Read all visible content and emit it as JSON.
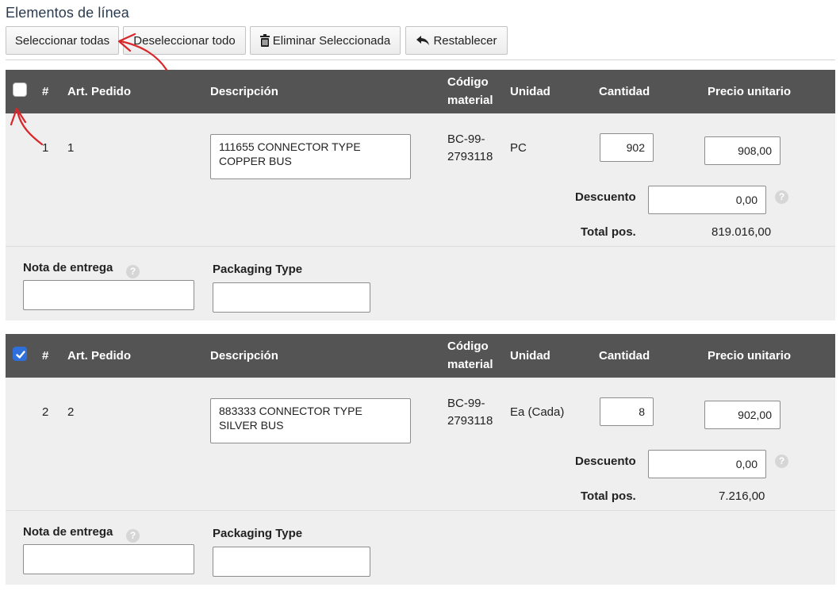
{
  "page": {
    "title": "Elementos de línea"
  },
  "toolbar": {
    "select_all": "Seleccionar todas",
    "deselect_all": "Deseleccionar todo",
    "delete_selected": "Eliminar Seleccionada",
    "reset": "Restablecer"
  },
  "columns": {
    "number": "#",
    "order_item": "Art. Pedido",
    "description": "Descripción",
    "material_code_line1": "Código",
    "material_code_line2": "material",
    "unit": "Unidad",
    "quantity": "Cantidad",
    "unit_price": "Precio unitario"
  },
  "labels": {
    "discount": "Descuento",
    "total": "Total pos.",
    "delivery_note": "Nota de entrega",
    "packaging_type": "Packaging Type"
  },
  "items": [
    {
      "checked": false,
      "number": "1",
      "order_item": "1",
      "description": "111655 CONNECTOR TYPE\nCOPPER BUS",
      "material_code_line1": "BC-99-",
      "material_code_line2": "2793118",
      "unit": "PC",
      "quantity": "902",
      "unit_price": "908,00",
      "discount": "0,00",
      "total": "819.016,00",
      "delivery_note": "",
      "packaging_type": ""
    },
    {
      "checked": true,
      "number": "2",
      "order_item": "2",
      "description": "883333 CONNECTOR TYPE\nSILVER BUS",
      "material_code_line1": "BC-99-",
      "material_code_line2": "2793118",
      "unit": "Ea (Cada)",
      "quantity": "8",
      "unit_price": "902,00",
      "discount": "0,00",
      "total": "7.216,00",
      "delivery_note": "",
      "packaging_type": ""
    }
  ],
  "colors": {
    "header_bg": "#545454",
    "item_bg": "#efefef",
    "checkbox_checked": "#2f6fdb",
    "annotation_arrow": "#d9262a"
  },
  "icons": {
    "delete": "trash-icon",
    "reset": "undo-arrow-icon",
    "help": "help-icon"
  }
}
